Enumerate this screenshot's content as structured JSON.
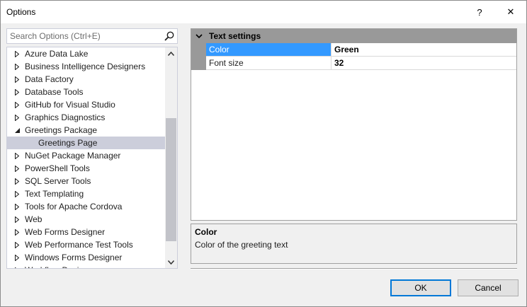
{
  "window": {
    "title": "Options",
    "help_glyph": "?",
    "close_glyph": "✕"
  },
  "search": {
    "placeholder": "Search Options (Ctrl+E)",
    "value": ""
  },
  "tree": {
    "items": [
      {
        "label": "Azure Data Lake",
        "state": "collapsed",
        "level": 0
      },
      {
        "label": "Business Intelligence Designers",
        "state": "collapsed",
        "level": 0
      },
      {
        "label": "Data Factory",
        "state": "collapsed",
        "level": 0
      },
      {
        "label": "Database Tools",
        "state": "collapsed",
        "level": 0
      },
      {
        "label": "GitHub for Visual Studio",
        "state": "collapsed",
        "level": 0
      },
      {
        "label": "Graphics Diagnostics",
        "state": "collapsed",
        "level": 0
      },
      {
        "label": "Greetings Package",
        "state": "expanded",
        "level": 0
      },
      {
        "label": "Greetings Page",
        "state": "leaf",
        "level": 1,
        "selected": true
      },
      {
        "label": "NuGet Package Manager",
        "state": "collapsed",
        "level": 0
      },
      {
        "label": "PowerShell Tools",
        "state": "collapsed",
        "level": 0
      },
      {
        "label": "SQL Server Tools",
        "state": "collapsed",
        "level": 0
      },
      {
        "label": "Text Templating",
        "state": "collapsed",
        "level": 0
      },
      {
        "label": "Tools for Apache Cordova",
        "state": "collapsed",
        "level": 0
      },
      {
        "label": "Web",
        "state": "collapsed",
        "level": 0
      },
      {
        "label": "Web Forms Designer",
        "state": "collapsed",
        "level": 0
      },
      {
        "label": "Web Performance Test Tools",
        "state": "collapsed",
        "level": 0
      },
      {
        "label": "Windows Forms Designer",
        "state": "collapsed",
        "level": 0
      },
      {
        "label": "Workflow Designer",
        "state": "collapsed",
        "level": 0,
        "cut": true
      }
    ]
  },
  "property_grid": {
    "category": "Text settings",
    "properties": [
      {
        "name": "Color",
        "value": "Green",
        "selected": true
      },
      {
        "name": "Font size",
        "value": "32",
        "selected": false
      }
    ]
  },
  "description": {
    "title": "Color",
    "text": "Color of the greeting text"
  },
  "buttons": {
    "ok": "OK",
    "cancel": "Cancel"
  },
  "colors": {
    "selection_blue": "#3399ff",
    "category_gray": "#999999",
    "tree_selected": "#cccedb",
    "accent_border": "#0078d7"
  }
}
